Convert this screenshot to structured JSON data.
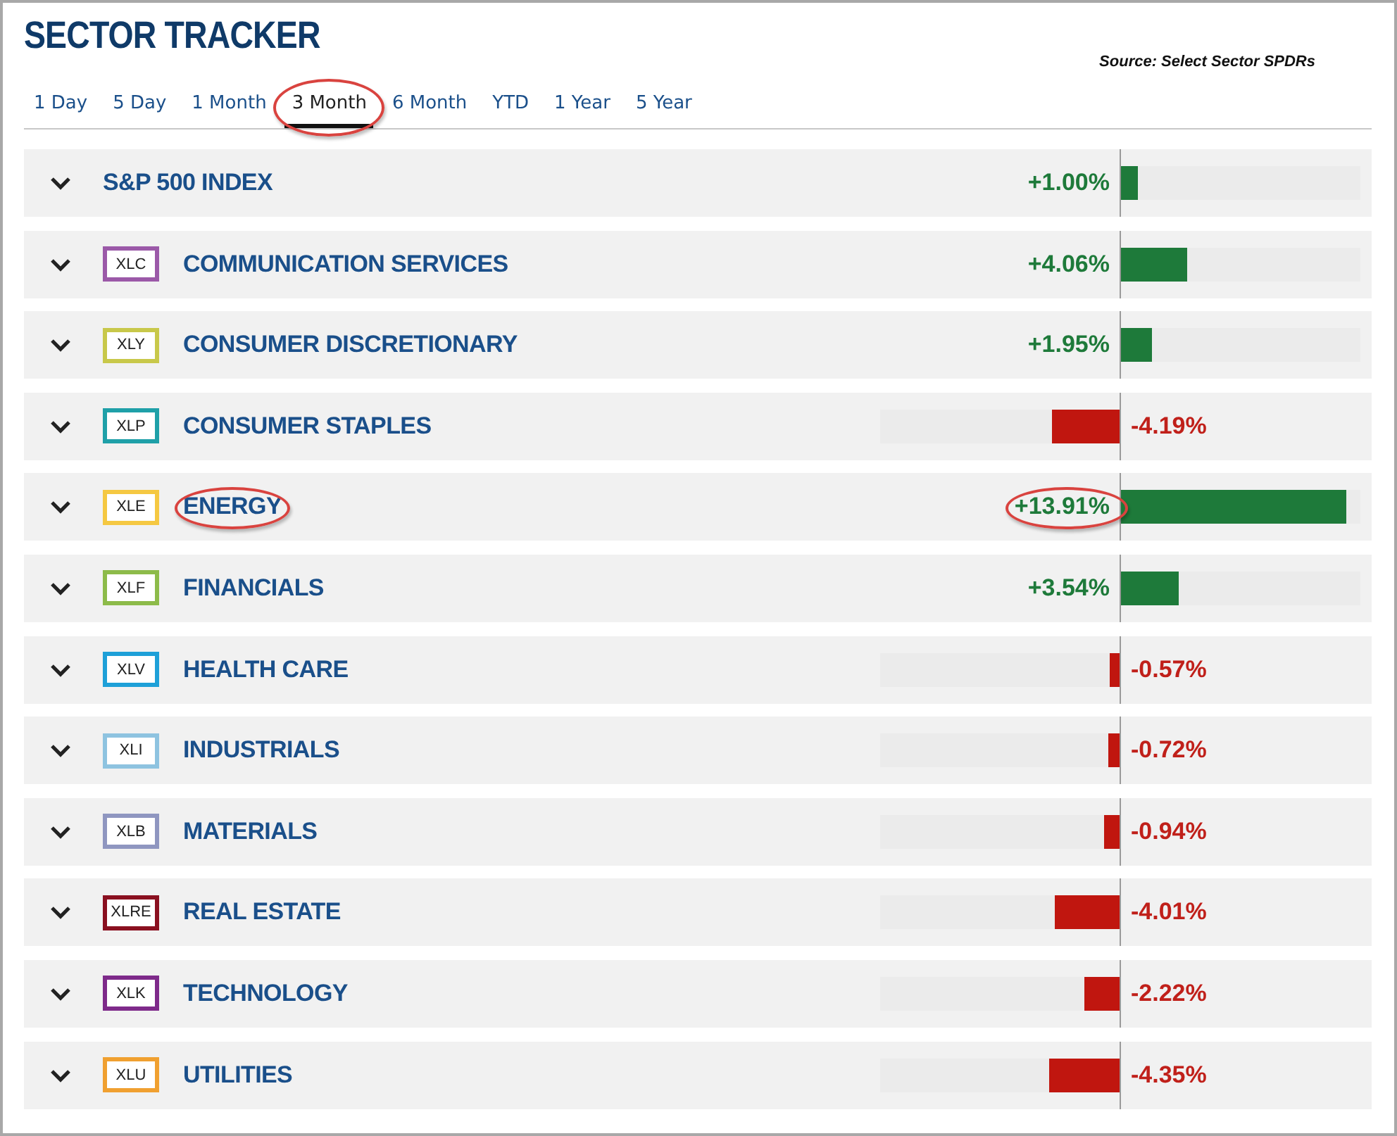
{
  "title": "SECTOR TRACKER",
  "source": "Source: Select Sector SPDRs",
  "tabs": [
    {
      "label": "1 Day",
      "selected": false,
      "circled": false
    },
    {
      "label": "5 Day",
      "selected": false,
      "circled": false
    },
    {
      "label": "1 Month",
      "selected": false,
      "circled": false
    },
    {
      "label": "3 Month",
      "selected": true,
      "circled": true
    },
    {
      "label": "6 Month",
      "selected": false,
      "circled": false
    },
    {
      "label": "YTD",
      "selected": false,
      "circled": false
    },
    {
      "label": "1 Year",
      "selected": false,
      "circled": false
    },
    {
      "label": "5 Year",
      "selected": false,
      "circled": false
    }
  ],
  "sectors": [
    {
      "name": "S&P 500 INDEX",
      "change": "+1.00%",
      "kind": "gain",
      "level": 0.068,
      "expanded": false,
      "name_circled": false,
      "change_circled": false
    },
    {
      "ticker": "XLC",
      "color": "#9b59a8",
      "name": "COMMUNICATION SERVICES",
      "change": "+4.06%",
      "kind": "gain",
      "level": 0.275,
      "expanded": false,
      "name_circled": false,
      "change_circled": false
    },
    {
      "ticker": "XLY",
      "color": "#c8c84a",
      "name": "CONSUMER DISCRETIONARY",
      "change": "+1.95%",
      "kind": "gain",
      "level": 0.132,
      "expanded": false,
      "name_circled": false,
      "change_circled": false
    },
    {
      "ticker": "XLP",
      "color": "#1fa0a8",
      "name": "CONSUMER STAPLES",
      "change": "-4.19%",
      "kind": "loss",
      "level": 0.283,
      "expanded": false,
      "name_circled": false,
      "change_circled": false
    },
    {
      "ticker": "XLE",
      "color": "#f5c842",
      "name": "ENERGY",
      "change": "+13.91%",
      "kind": "gain",
      "level": 0.941,
      "expanded": false,
      "name_circled": true,
      "change_circled": true
    },
    {
      "ticker": "XLF",
      "color": "#8dbb4a",
      "name": "FINANCIALS",
      "change": "+3.54%",
      "kind": "gain",
      "level": 0.239,
      "expanded": false,
      "name_circled": false,
      "change_circled": false
    },
    {
      "ticker": "XLV",
      "color": "#1ea0d8",
      "name": "HEALTH CARE",
      "change": "-0.57%",
      "kind": "loss",
      "level": 0.039,
      "expanded": false,
      "name_circled": false,
      "change_circled": false
    },
    {
      "ticker": "XLI",
      "color": "#8ec3e0",
      "name": "INDUSTRIALS",
      "change": "-0.72%",
      "kind": "loss",
      "level": 0.049,
      "expanded": false,
      "name_circled": false,
      "change_circled": false
    },
    {
      "ticker": "XLB",
      "color": "#8f96c0",
      "name": "MATERIALS",
      "change": "-0.94%",
      "kind": "loss",
      "level": 0.064,
      "expanded": false,
      "name_circled": false,
      "change_circled": false
    },
    {
      "ticker": "XLRE",
      "color": "#8a1020",
      "name": "REAL ESTATE",
      "change": "-4.01%",
      "kind": "loss",
      "level": 0.271,
      "expanded": false,
      "name_circled": false,
      "change_circled": false
    },
    {
      "ticker": "XLK",
      "color": "#7e2a8a",
      "name": "TECHNOLOGY",
      "change": "-2.22%",
      "kind": "loss",
      "level": 0.15,
      "expanded": false,
      "name_circled": false,
      "change_circled": false
    },
    {
      "ticker": "XLU",
      "color": "#f0a030",
      "name": "UTILITIES",
      "change": "-4.35%",
      "kind": "loss",
      "level": 0.294,
      "expanded": false,
      "name_circled": false,
      "change_circled": false
    }
  ]
}
